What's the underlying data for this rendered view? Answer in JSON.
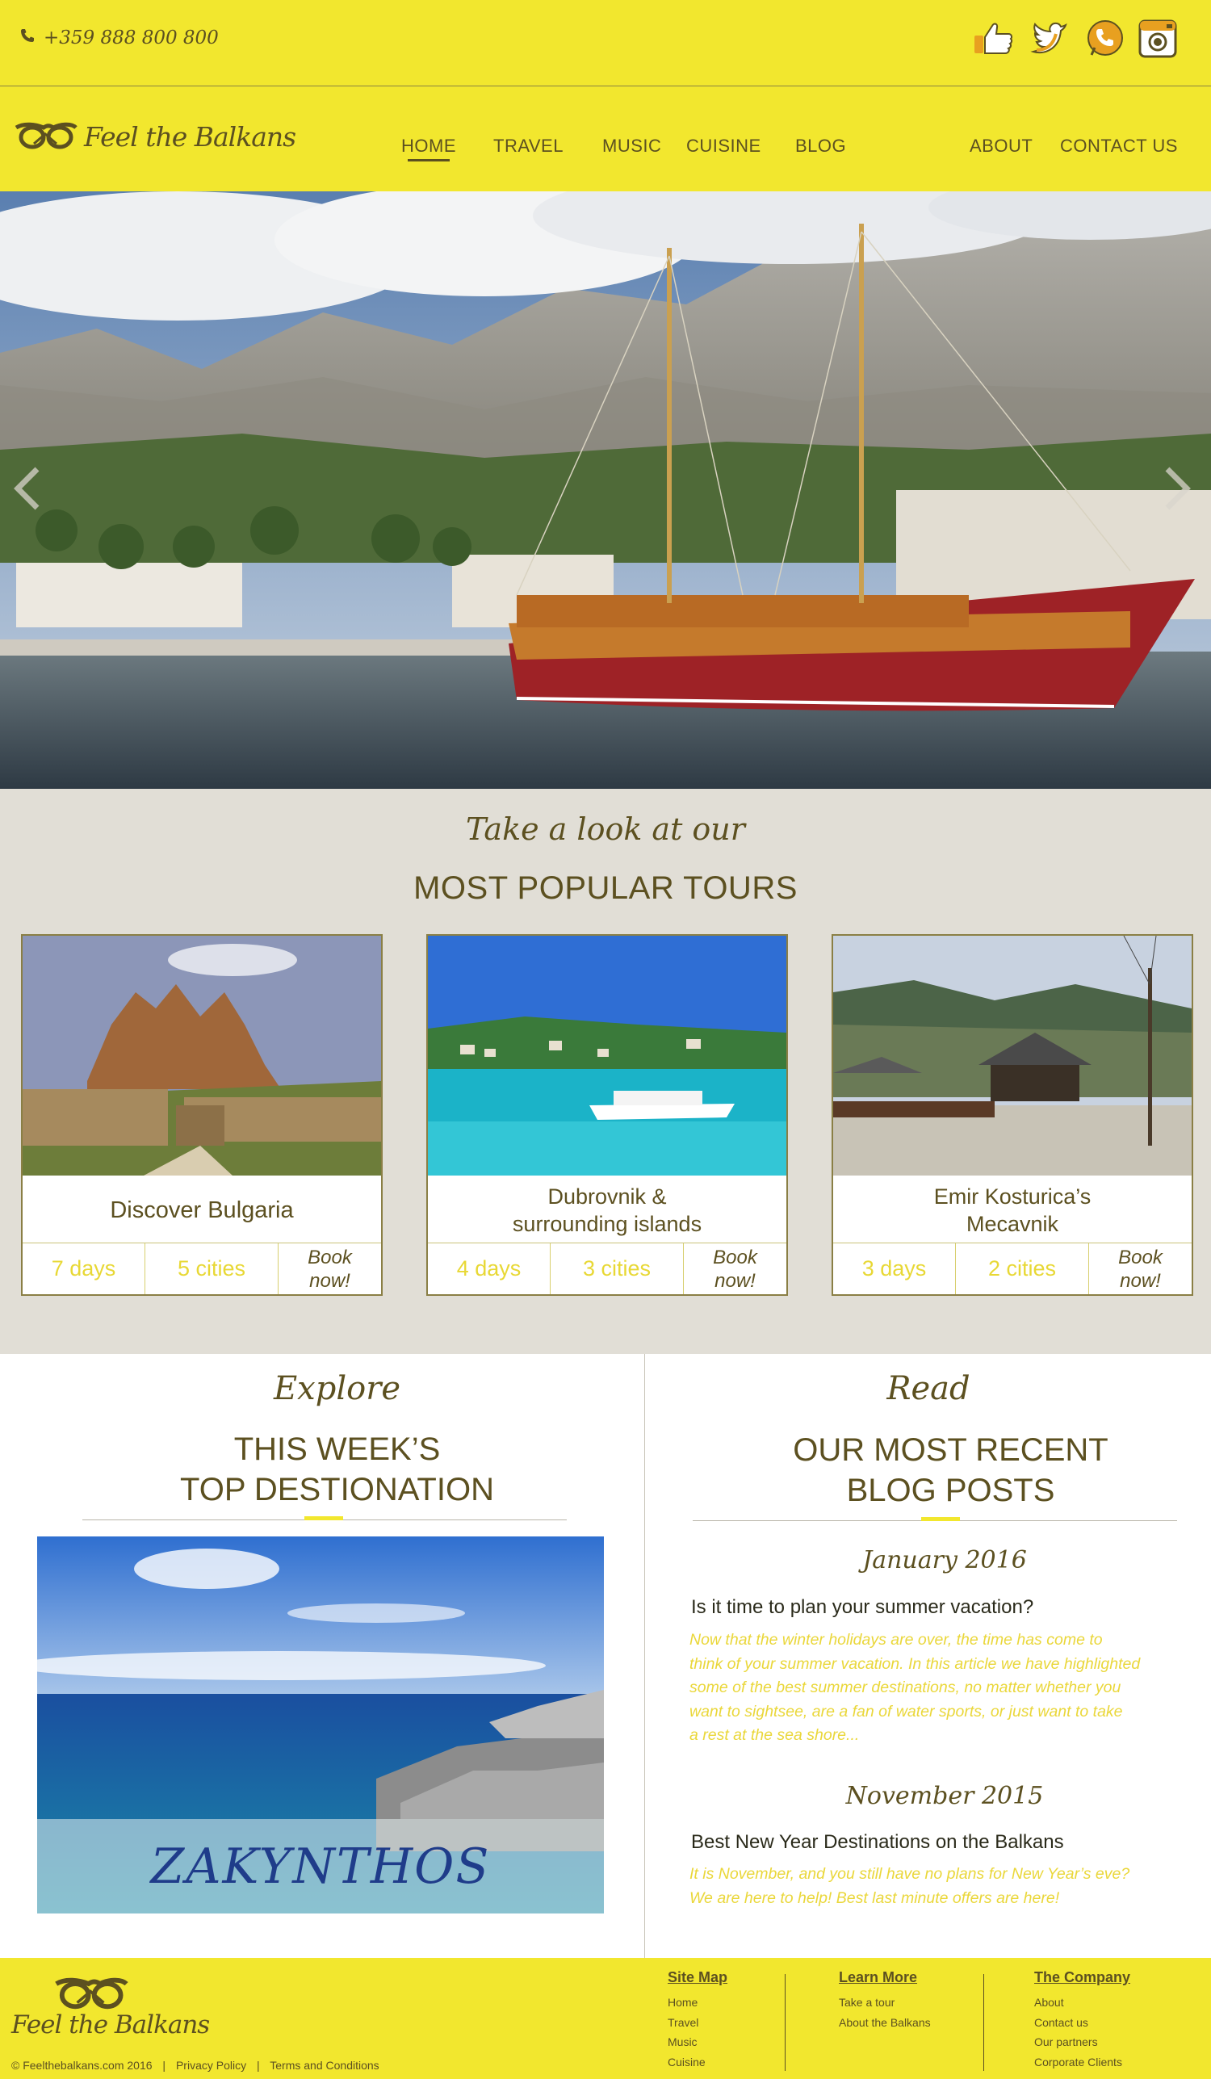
{
  "topbar": {
    "phone": "+359 888 800 800",
    "social_icons": [
      "thumbs-up-icon",
      "twitter-bird-icon",
      "phone-chat-icon",
      "instagram-camera-icon"
    ]
  },
  "brand": {
    "name": "Feel the Balkans",
    "color_yellow": "#f2e72e",
    "color_olive": "#5c5020"
  },
  "nav": {
    "items": [
      {
        "label": "HOME",
        "active": true
      },
      {
        "label": "TRAVEL"
      },
      {
        "label": "MUSIC"
      },
      {
        "label": "CUISINE"
      },
      {
        "label": "BLOG"
      },
      {
        "label": "ABOUT"
      },
      {
        "label": "CONTACT US"
      }
    ]
  },
  "hero": {
    "controls": [
      "chevron-left-icon",
      "chevron-right-icon"
    ]
  },
  "tours": {
    "script": "Take a look at our",
    "title": "MOST POPULAR TOURS",
    "cards": [
      {
        "title": "Discover Bulgaria",
        "days": "7 days",
        "cities": "5 cities",
        "book_1": "Book",
        "book_2": "now!"
      },
      {
        "title_1": "Dubrovnik &",
        "title_2": "surrounding islands",
        "days": "4 days",
        "cities": "3 cities",
        "book_1": "Book",
        "book_2": "now!"
      },
      {
        "title_1": "Emir Kosturica’s",
        "title_2": "Mecavnik",
        "days": "3 days",
        "cities": "2 cities",
        "book_1": "Book",
        "book_2": "now!"
      }
    ]
  },
  "explore": {
    "script": "Explore",
    "title_1": "THIS WEEK’S",
    "title_2": "TOP DESTIONATION",
    "destination": "ZAKYNTHOS"
  },
  "blog": {
    "script": "Read",
    "title_1": "OUR MOST RECENT",
    "title_2": "BLOG POSTS",
    "posts": [
      {
        "date": "January 2016",
        "title": "Is it time to plan your summer vacation?",
        "body_lines": [
          "Now that the winter holidays are over, the time has come to",
          "think of your summer vacation. In this article we have highlighted",
          "some of the best summer destinations, no matter whether you",
          "want to sightsee, are a fan of water sports, or just want to take",
          "a rest at the sea shore..."
        ]
      },
      {
        "date": "November 2015",
        "title": "Best New Year Destinations on the Balkans",
        "body_lines": [
          "It is November, and you still have no plans for New Year’s eve?",
          "We are here to help! Best last minute offers are here!"
        ]
      }
    ]
  },
  "footer": {
    "brand": "Feel the Balkans",
    "copyright": "© Feelthebalkans.com 2016",
    "privacy": "Privacy Policy",
    "terms": "Terms and Conditions",
    "sep": "|",
    "columns": [
      {
        "heading": "Site Map",
        "links": [
          "Home",
          "Travel",
          "Music",
          "Cuisine"
        ]
      },
      {
        "heading": "Learn More",
        "links": [
          "Take a tour",
          "About the Balkans"
        ]
      },
      {
        "heading": "The Company",
        "links": [
          "About",
          "Contact us",
          "Our partners",
          "Corporate Clients"
        ]
      }
    ]
  }
}
